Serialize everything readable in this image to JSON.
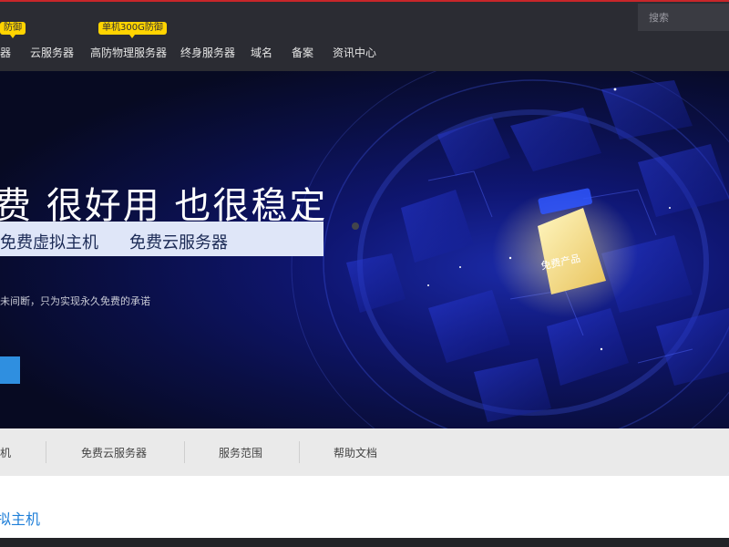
{
  "nav": {
    "items": [
      {
        "label": "器"
      },
      {
        "label": "云服务器"
      },
      {
        "label": "高防物理服务器"
      },
      {
        "label": "终身服务器"
      },
      {
        "label": "域名"
      },
      {
        "label": "备案"
      },
      {
        "label": "资讯中心"
      }
    ],
    "badges": [
      "防御",
      "单机300G防御"
    ],
    "search_placeholder": "搜索"
  },
  "hero": {
    "title": "费 很好用 也很稳定",
    "band_items": [
      "免费虚拟主机",
      "免费云服务器"
    ],
    "description": "未间断，只为实现永久免费的承诺",
    "tag": "免费产品"
  },
  "subnav": {
    "items": [
      "机",
      "免费云服务器",
      "服务范围",
      "帮助文档"
    ]
  },
  "section": {
    "heading": "拟主机"
  },
  "colors": {
    "navbar_bg": "#2b2c33",
    "accent_line": "#c8262a",
    "badge": "#ffd400",
    "hero_bg": "#0a0f45",
    "button": "#2f8fe0",
    "heading": "#1f7fd8"
  }
}
